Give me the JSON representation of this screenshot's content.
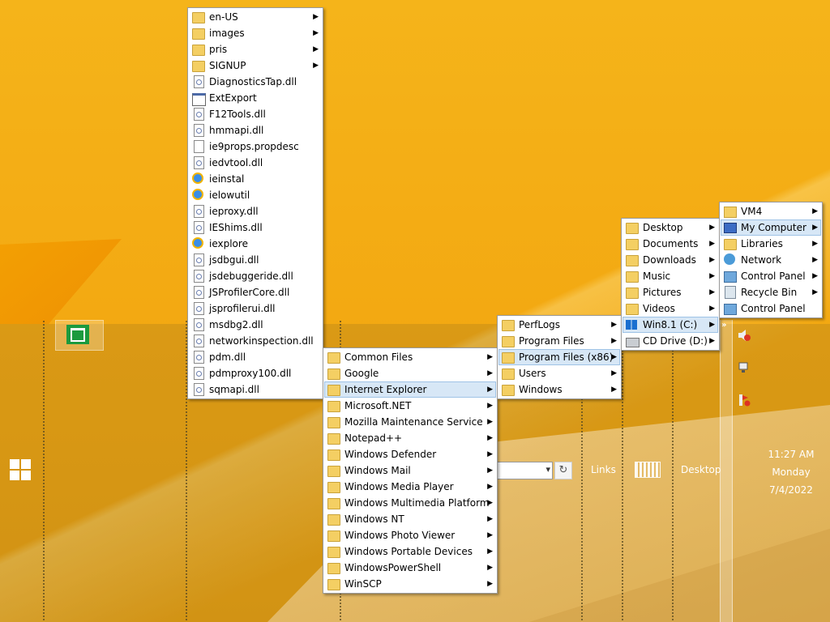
{
  "menus": {
    "ie_folder": {
      "items": [
        {
          "label": "en-US",
          "icon": "folder-icon",
          "submenu": true
        },
        {
          "label": "images",
          "icon": "folder-icon",
          "submenu": true
        },
        {
          "label": "pris",
          "icon": "folder-icon",
          "submenu": true
        },
        {
          "label": "SIGNUP",
          "icon": "folder-icon",
          "submenu": true
        },
        {
          "label": "DiagnosticsTap.dll",
          "icon": "dll-file-icon",
          "submenu": false
        },
        {
          "label": "ExtExport",
          "icon": "application-icon",
          "submenu": false
        },
        {
          "label": "F12Tools.dll",
          "icon": "dll-file-icon",
          "submenu": false
        },
        {
          "label": "hmmapi.dll",
          "icon": "dll-file-icon",
          "submenu": false
        },
        {
          "label": "ie9props.propdesc",
          "icon": "blank-file-icon",
          "submenu": false
        },
        {
          "label": "iedvtool.dll",
          "icon": "dll-file-icon",
          "submenu": false
        },
        {
          "label": "ieinstal",
          "icon": "internet-explorer-icon",
          "submenu": false
        },
        {
          "label": "ielowutil",
          "icon": "internet-explorer-icon",
          "submenu": false
        },
        {
          "label": "ieproxy.dll",
          "icon": "dll-file-icon",
          "submenu": false
        },
        {
          "label": "IEShims.dll",
          "icon": "dll-file-icon",
          "submenu": false
        },
        {
          "label": "iexplore",
          "icon": "internet-explorer-icon",
          "submenu": false
        },
        {
          "label": "jsdbgui.dll",
          "icon": "dll-file-icon",
          "submenu": false
        },
        {
          "label": "jsdebuggeride.dll",
          "icon": "dll-file-icon",
          "submenu": false
        },
        {
          "label": "JSProfilerCore.dll",
          "icon": "dll-file-icon",
          "submenu": false
        },
        {
          "label": "jsprofilerui.dll",
          "icon": "dll-file-icon",
          "submenu": false
        },
        {
          "label": "msdbg2.dll",
          "icon": "dll-file-icon",
          "submenu": false
        },
        {
          "label": "networkinspection.dll",
          "icon": "dll-file-icon",
          "submenu": false
        },
        {
          "label": "pdm.dll",
          "icon": "dll-file-icon",
          "submenu": false
        },
        {
          "label": "pdmproxy100.dll",
          "icon": "dll-file-icon",
          "submenu": false
        },
        {
          "label": "sqmapi.dll",
          "icon": "dll-file-icon",
          "submenu": false
        }
      ]
    },
    "program_files_x86": {
      "highlighted": "Internet Explorer",
      "items": [
        {
          "label": "Common Files"
        },
        {
          "label": "Google"
        },
        {
          "label": "Internet Explorer"
        },
        {
          "label": "Microsoft.NET"
        },
        {
          "label": "Mozilla Maintenance Service"
        },
        {
          "label": "Notepad++"
        },
        {
          "label": "Windows Defender"
        },
        {
          "label": "Windows Mail"
        },
        {
          "label": "Windows Media Player"
        },
        {
          "label": "Windows Multimedia Platform"
        },
        {
          "label": "Windows NT"
        },
        {
          "label": "Windows Photo Viewer"
        },
        {
          "label": "Windows Portable Devices"
        },
        {
          "label": "WindowsPowerShell"
        },
        {
          "label": "WinSCP"
        }
      ]
    },
    "drive_c": {
      "highlighted": "Program Files (x86)",
      "items": [
        {
          "label": "PerfLogs"
        },
        {
          "label": "Program Files"
        },
        {
          "label": "Program Files (x86)"
        },
        {
          "label": "Users"
        },
        {
          "label": "Windows"
        }
      ]
    },
    "my_computer": {
      "highlighted": "Win8.1 (C:)",
      "items": [
        {
          "label": "Desktop",
          "icon": "folder-icon"
        },
        {
          "label": "Documents",
          "icon": "folder-icon"
        },
        {
          "label": "Downloads",
          "icon": "folder-icon"
        },
        {
          "label": "Music",
          "icon": "folder-icon"
        },
        {
          "label": "Pictures",
          "icon": "folder-icon"
        },
        {
          "label": "Videos",
          "icon": "folder-icon"
        },
        {
          "label": "Win8.1 (C:)",
          "icon": "windows-drive-icon"
        },
        {
          "label": "CD Drive (D:)",
          "icon": "cd-drive-icon"
        }
      ]
    },
    "root": {
      "highlighted": "My Computer",
      "items": [
        {
          "label": "VM4",
          "icon": "user-folder-icon",
          "submenu": true
        },
        {
          "label": "My Computer",
          "icon": "computer-icon",
          "submenu": true
        },
        {
          "label": "Libraries",
          "icon": "libraries-icon",
          "submenu": true
        },
        {
          "label": "Network",
          "icon": "network-icon",
          "submenu": true
        },
        {
          "label": "Control Panel",
          "icon": "control-panel-icon",
          "submenu": true
        },
        {
          "label": "Recycle Bin",
          "icon": "recycle-bin-icon",
          "submenu": true
        },
        {
          "label": "Control Panel",
          "icon": "control-panel-icon",
          "submenu": false
        }
      ]
    }
  },
  "taskbar": {
    "links_label": "Links",
    "desktop_label": "Desktop",
    "overflow_chevron": "»",
    "clock": {
      "time": "11:27 AM",
      "day": "Monday",
      "date": "7/4/2022"
    }
  },
  "colors": {
    "highlight": "#d7e7f6",
    "store_green": "#1b9a3e"
  }
}
